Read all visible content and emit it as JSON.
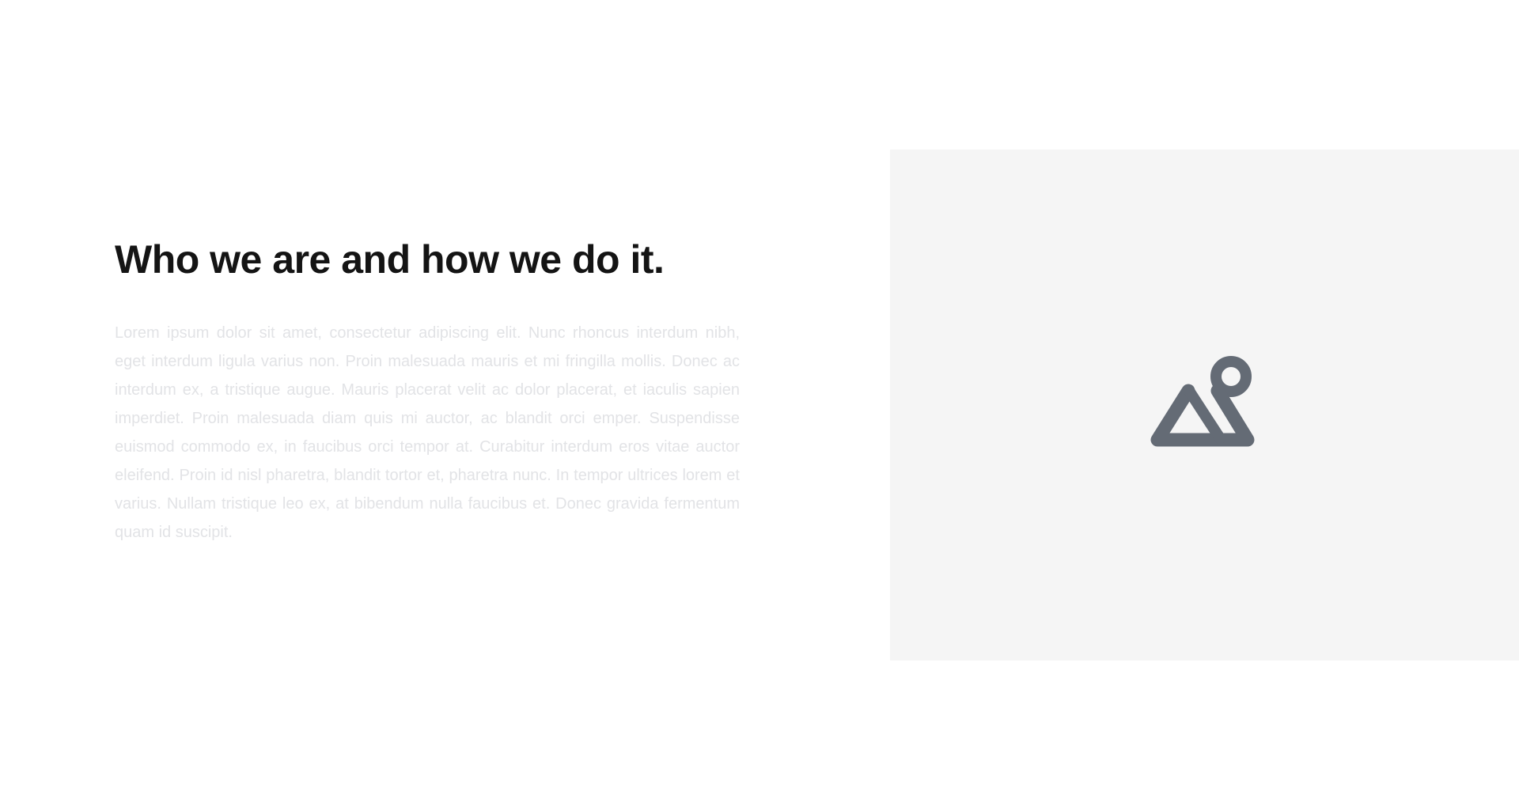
{
  "about": {
    "heading": "Who we are and how we do it.",
    "body": "Lorem ipsum dolor sit amet, consectetur adipiscing elit. Nunc rhoncus interdum nibh, eget interdum ligula varius non. Proin malesuada mauris et mi fringilla mollis. Donec ac interdum ex, a tristique augue. Mauris placerat velit ac dolor placerat, et iaculis sapien imperdiet. Proin malesuada diam quis mi auctor, ac blandit orci emper. Suspendisse euismod commodo ex, in faucibus orci tempor at. Curabitur interdum eros vitae auctor eleifend. Proin id nisl pharetra, blandit tortor et, pharetra nunc. In tempor ultrices lorem et varius. Nullam tristique leo ex, at bibendum nulla faucibus et. Donec gravida fermentum quam id suscipit."
  },
  "media": {
    "icon": "image-placeholder-icon"
  },
  "colors": {
    "heading": "#141414",
    "body_text": "#e2e3e6",
    "placeholder_bg": "#f5f5f5",
    "icon": "#646b75",
    "page_bg": "#ffffff"
  }
}
